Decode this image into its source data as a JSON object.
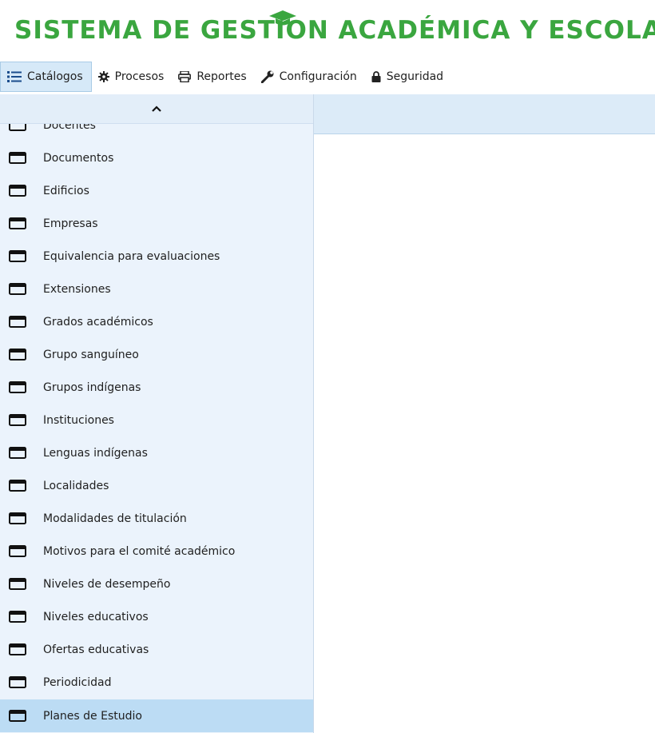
{
  "header": {
    "title": "SISTEMA DE GESTION ACADÉMICA Y ESCOLAR",
    "title_color": "#3aa63f"
  },
  "menubar": {
    "items": [
      {
        "label": "Catálogos",
        "icon": "list-icon",
        "active": true
      },
      {
        "label": "Procesos",
        "icon": "gear-icon"
      },
      {
        "label": "Reportes",
        "icon": "printer-icon"
      },
      {
        "label": "Configuración",
        "icon": "wrench-icon"
      },
      {
        "label": "Seguridad",
        "icon": "lock-icon"
      }
    ]
  },
  "dropdown": {
    "scroll_up_icon": "chevron-up-icon",
    "item_icon": "window-icon",
    "partial_item": "Docentes",
    "items": [
      "Documentos",
      "Edificios",
      "Empresas",
      "Equivalencia para evaluaciones",
      "Extensiones",
      "Grados académicos",
      "Grupo sanguíneo",
      "Grupos indígenas",
      "Instituciones",
      "Lenguas indígenas",
      "Localidades",
      "Modalidades de titulación",
      "Motivos para el comité académico",
      "Niveles de desempeño",
      "Niveles educativos",
      "Ofertas educativas",
      "Periodicidad",
      "Planes de Estudio"
    ],
    "highlighted_item": "Planes de Estudio"
  },
  "colors": {
    "menu_bg": "#ebf3fc",
    "highlight": "#bcdcf4",
    "active_tab": "#d6e9f8"
  }
}
